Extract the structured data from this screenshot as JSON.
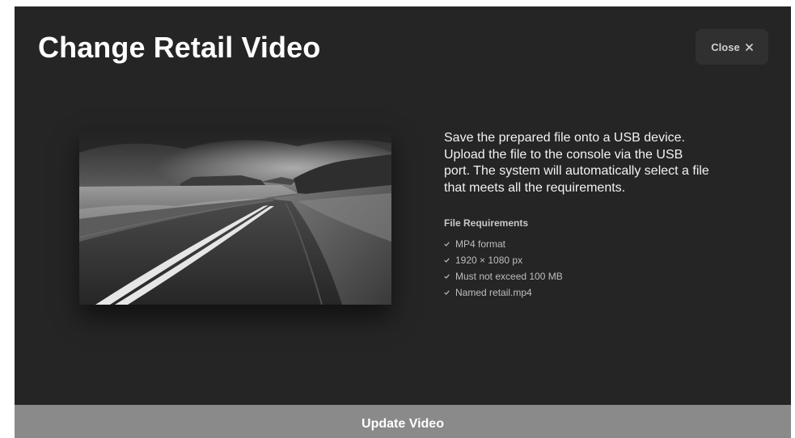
{
  "header": {
    "title": "Change Retail Video",
    "close_label": "Close",
    "close_icon": "close-icon"
  },
  "preview": {
    "image": "black-and-white road landscape photo"
  },
  "instructions": {
    "text": "Save the prepared file onto a USB device. Upload the file to the console via the USB port. The system will automatically select a file that meets all the requirements."
  },
  "requirements": {
    "heading": "File Requirements",
    "items": [
      {
        "icon": "check-icon",
        "label": "MP4 format"
      },
      {
        "icon": "check-icon",
        "label": "1920 × 1080 px"
      },
      {
        "icon": "check-icon",
        "label": "Must not exceed 100 MB"
      },
      {
        "icon": "check-icon",
        "label": "Named retail.mp4"
      }
    ]
  },
  "footer": {
    "update_label": "Update Video"
  },
  "colors": {
    "panel_bg": "#252525",
    "close_bg": "#303030",
    "update_bg": "#8a8a8a",
    "text_primary": "#ffffff"
  }
}
